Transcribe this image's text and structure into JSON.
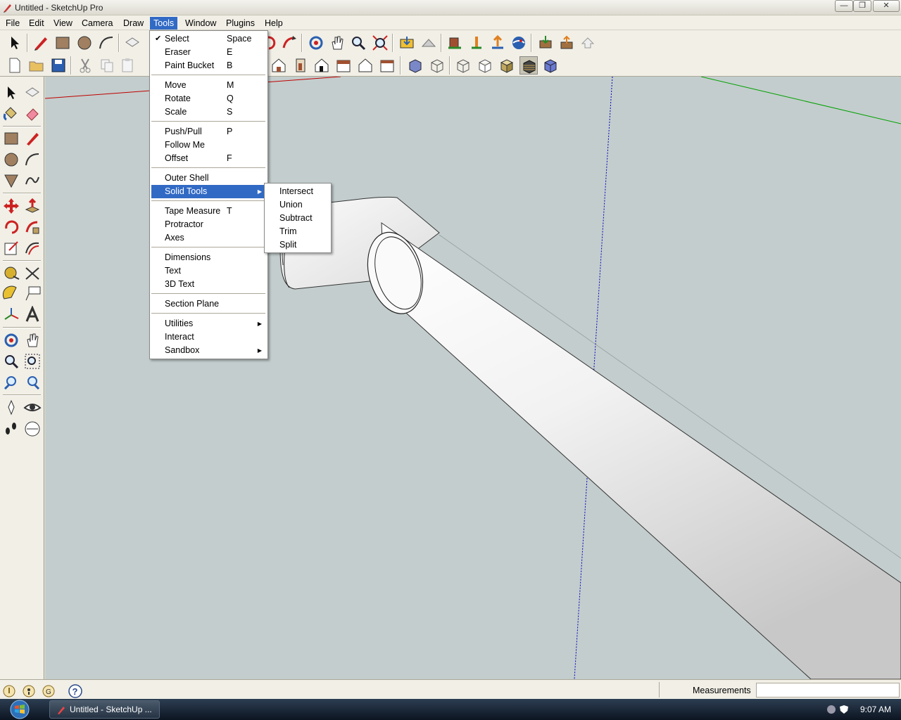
{
  "window": {
    "title": "Untitled - SketchUp Pro",
    "controls": {
      "minimize": "—",
      "restore": "❐",
      "close": "✕"
    }
  },
  "menubar": [
    "File",
    "Edit",
    "View",
    "Camera",
    "Draw",
    "Tools",
    "Window",
    "Plugins",
    "Help"
  ],
  "tools_menu": {
    "groups": [
      [
        {
          "label": "Select",
          "key": "Space",
          "checked": true
        },
        {
          "label": "Eraser",
          "key": "E"
        },
        {
          "label": "Paint Bucket",
          "key": "B"
        }
      ],
      [
        {
          "label": "Move",
          "key": "M"
        },
        {
          "label": "Rotate",
          "key": "Q"
        },
        {
          "label": "Scale",
          "key": "S"
        }
      ],
      [
        {
          "label": "Push/Pull",
          "key": "P"
        },
        {
          "label": "Follow Me",
          "key": ""
        },
        {
          "label": "Offset",
          "key": "F"
        }
      ],
      [
        {
          "label": "Outer Shell",
          "key": ""
        },
        {
          "label": "Solid Tools",
          "key": "",
          "submenu": true,
          "highlighted": true
        }
      ],
      [
        {
          "label": "Tape Measure",
          "key": "T"
        },
        {
          "label": "Protractor",
          "key": ""
        },
        {
          "label": "Axes",
          "key": ""
        }
      ],
      [
        {
          "label": "Dimensions",
          "key": ""
        },
        {
          "label": "Text",
          "key": ""
        },
        {
          "label": "3D Text",
          "key": ""
        }
      ],
      [
        {
          "label": "Section Plane",
          "key": ""
        }
      ],
      [
        {
          "label": "Utilities",
          "key": "",
          "submenu": true
        },
        {
          "label": "Interact",
          "key": ""
        },
        {
          "label": "Sandbox",
          "key": "",
          "submenu": true
        }
      ]
    ]
  },
  "solid_tools_submenu": [
    "Intersect",
    "Union",
    "Subtract",
    "Trim",
    "Split"
  ],
  "statusbar": {
    "measurements_label": "Measurements",
    "measurements_value": "",
    "help_glyph": "?"
  },
  "taskbar": {
    "task_label": "Untitled - SketchUp ...",
    "clock": "9:07 AM"
  },
  "colors": {
    "viewport_bg": "#c3cdcd",
    "menu_highlight": "#316ac5",
    "axis_red": "#c00000",
    "axis_green": "#00a000",
    "axis_blue": "#0000c0"
  }
}
